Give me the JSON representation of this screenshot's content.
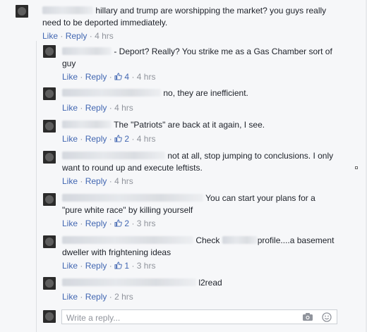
{
  "actions": {
    "like": "Like",
    "reply": "Reply",
    "sep": "·"
  },
  "comments": [
    {
      "text_before": "",
      "text": "hillary and trump are worshipping the market? you guys really need to be deported immediately.",
      "likes": "",
      "time": "4 hrs"
    },
    {
      "text": "- Deport? Really? You strike me as a Gas Chamber sort of guy",
      "likes": "4",
      "time": "4 hrs"
    },
    {
      "text": "no, they are inefficient.",
      "likes": "",
      "time": "4 hrs"
    },
    {
      "text": "The \"Patriots\" are back at it again, I see.",
      "likes": "2",
      "time": "4 hrs"
    },
    {
      "text": "not at all, stop jumping to conclusions. I only want to round up and execute leftists.",
      "likes": "",
      "time": "4 hrs"
    },
    {
      "text": "You can start your plans for a \"pure white race\" by killing yourself",
      "likes": "2",
      "time": "3 hrs"
    },
    {
      "text_a": "Check",
      "text_b": "profile....a basement dweller with frightening ideas",
      "likes": "1",
      "time": "3 hrs"
    },
    {
      "text": "l2read",
      "likes": "",
      "time": "2 hrs"
    }
  ],
  "reply_box": {
    "placeholder": "Write a reply..."
  },
  "icons": {
    "like": "thumbs-up-icon",
    "camera": "camera-icon",
    "emoji": "smiley-icon"
  },
  "colors": {
    "link": "#4267b2",
    "meta": "#90949c",
    "background": "#f6f7f9"
  }
}
